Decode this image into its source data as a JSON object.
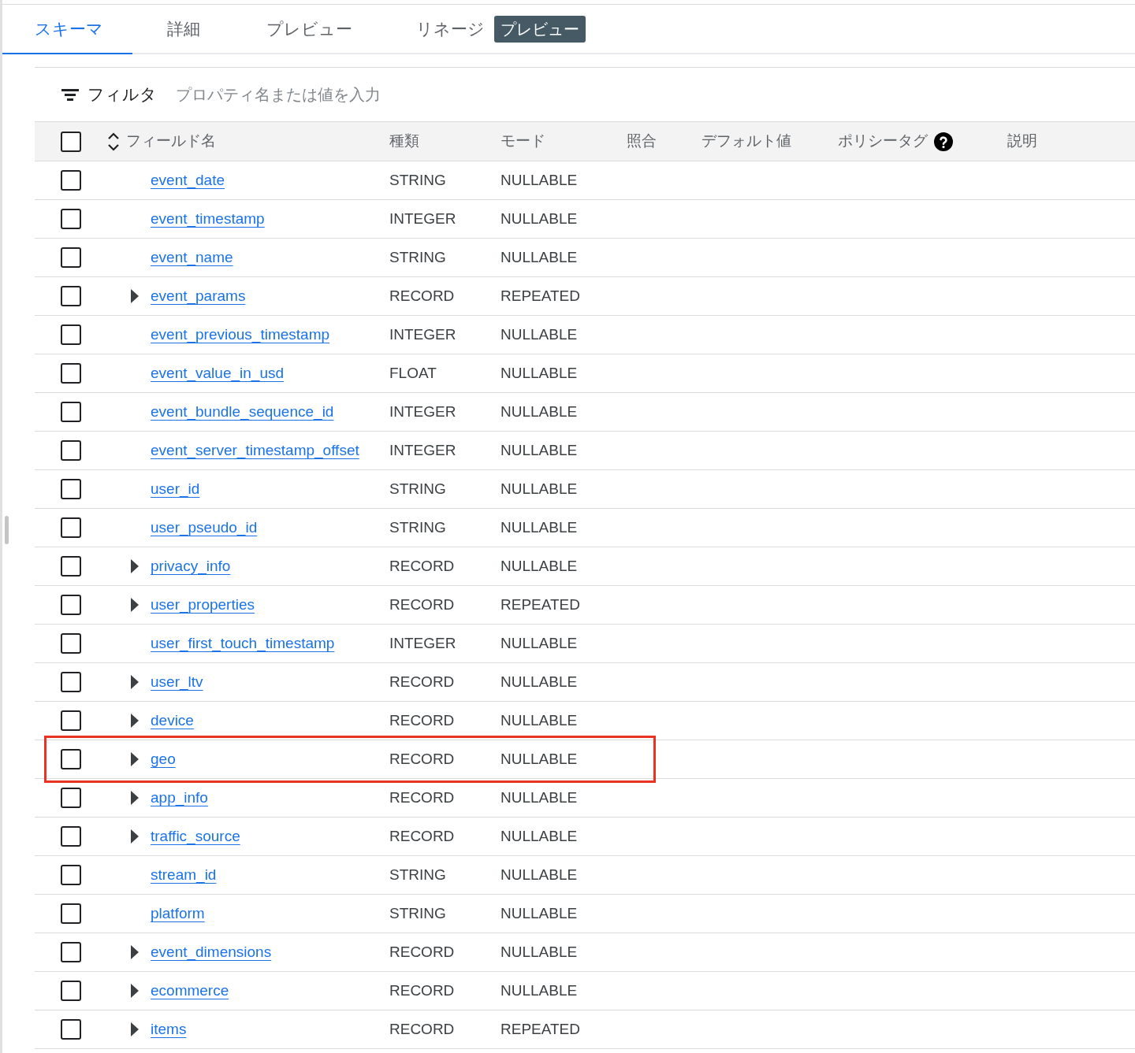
{
  "tabs": [
    {
      "label": "スキーマ",
      "selected": true
    },
    {
      "label": "詳細",
      "selected": false
    },
    {
      "label": "プレビュー",
      "selected": false
    },
    {
      "label": "リネージ",
      "selected": false,
      "badge": "プレビュー"
    }
  ],
  "filter": {
    "label": "フィルタ",
    "placeholder": "プロパティ名または値を入力"
  },
  "table": {
    "select_all": {
      "checked": false
    },
    "columns": [
      "フィールド名",
      "種類",
      "モード",
      "照合",
      "デフォルト値",
      "ポリシータグ",
      "説明"
    ],
    "rows": [
      {
        "name": "event_date",
        "type": "STRING",
        "mode": "NULLABLE",
        "expandable": false,
        "checked": false,
        "highlighted": false
      },
      {
        "name": "event_timestamp",
        "type": "INTEGER",
        "mode": "NULLABLE",
        "expandable": false,
        "checked": false,
        "highlighted": false
      },
      {
        "name": "event_name",
        "type": "STRING",
        "mode": "NULLABLE",
        "expandable": false,
        "checked": false,
        "highlighted": false
      },
      {
        "name": "event_params",
        "type": "RECORD",
        "mode": "REPEATED",
        "expandable": true,
        "checked": false,
        "highlighted": false
      },
      {
        "name": "event_previous_timestamp",
        "type": "INTEGER",
        "mode": "NULLABLE",
        "expandable": false,
        "checked": false,
        "highlighted": false
      },
      {
        "name": "event_value_in_usd",
        "type": "FLOAT",
        "mode": "NULLABLE",
        "expandable": false,
        "checked": false,
        "highlighted": false
      },
      {
        "name": "event_bundle_sequence_id",
        "type": "INTEGER",
        "mode": "NULLABLE",
        "expandable": false,
        "checked": false,
        "highlighted": false
      },
      {
        "name": "event_server_timestamp_offset",
        "type": "INTEGER",
        "mode": "NULLABLE",
        "expandable": false,
        "checked": false,
        "highlighted": false
      },
      {
        "name": "user_id",
        "type": "STRING",
        "mode": "NULLABLE",
        "expandable": false,
        "checked": false,
        "highlighted": false
      },
      {
        "name": "user_pseudo_id",
        "type": "STRING",
        "mode": "NULLABLE",
        "expandable": false,
        "checked": false,
        "highlighted": false
      },
      {
        "name": "privacy_info",
        "type": "RECORD",
        "mode": "NULLABLE",
        "expandable": true,
        "checked": false,
        "highlighted": false
      },
      {
        "name": "user_properties",
        "type": "RECORD",
        "mode": "REPEATED",
        "expandable": true,
        "checked": false,
        "highlighted": false
      },
      {
        "name": "user_first_touch_timestamp",
        "type": "INTEGER",
        "mode": "NULLABLE",
        "expandable": false,
        "checked": false,
        "highlighted": false
      },
      {
        "name": "user_ltv",
        "type": "RECORD",
        "mode": "NULLABLE",
        "expandable": true,
        "checked": false,
        "highlighted": false
      },
      {
        "name": "device",
        "type": "RECORD",
        "mode": "NULLABLE",
        "expandable": true,
        "checked": false,
        "highlighted": false
      },
      {
        "name": "geo",
        "type": "RECORD",
        "mode": "NULLABLE",
        "expandable": true,
        "checked": false,
        "highlighted": true
      },
      {
        "name": "app_info",
        "type": "RECORD",
        "mode": "NULLABLE",
        "expandable": true,
        "checked": false,
        "highlighted": false
      },
      {
        "name": "traffic_source",
        "type": "RECORD",
        "mode": "NULLABLE",
        "expandable": true,
        "checked": false,
        "highlighted": false
      },
      {
        "name": "stream_id",
        "type": "STRING",
        "mode": "NULLABLE",
        "expandable": false,
        "checked": false,
        "highlighted": false
      },
      {
        "name": "platform",
        "type": "STRING",
        "mode": "NULLABLE",
        "expandable": false,
        "checked": false,
        "highlighted": false
      },
      {
        "name": "event_dimensions",
        "type": "RECORD",
        "mode": "NULLABLE",
        "expandable": true,
        "checked": false,
        "highlighted": false
      },
      {
        "name": "ecommerce",
        "type": "RECORD",
        "mode": "NULLABLE",
        "expandable": true,
        "checked": false,
        "highlighted": false
      },
      {
        "name": "items",
        "type": "RECORD",
        "mode": "REPEATED",
        "expandable": true,
        "checked": false,
        "highlighted": false
      }
    ]
  }
}
